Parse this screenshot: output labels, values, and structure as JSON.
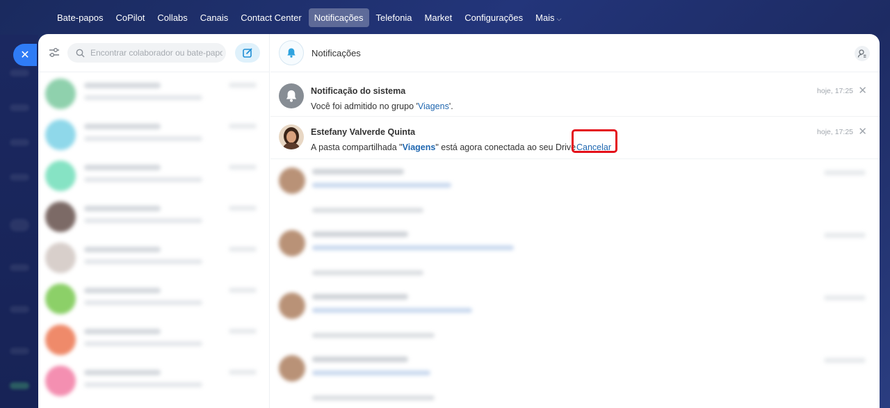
{
  "nav": {
    "items": [
      {
        "label": "Bate-papos",
        "active": false
      },
      {
        "label": "CoPilot",
        "active": false
      },
      {
        "label": "Collabs",
        "active": false
      },
      {
        "label": "Canais",
        "active": false
      },
      {
        "label": "Contact Center",
        "active": false
      },
      {
        "label": "Notificações",
        "active": true
      },
      {
        "label": "Telefonia",
        "active": false
      },
      {
        "label": "Market",
        "active": false
      },
      {
        "label": "Configurações",
        "active": false
      }
    ],
    "more_label": "Mais"
  },
  "chatlist": {
    "search_placeholder": "Encontrar colaborador ou bate-papo",
    "avatar_colors": [
      "#8fd1ad",
      "#8fd8ea",
      "#86e3c4",
      "#7c6a66",
      "#d8cfcb",
      "#8cd068",
      "#ef8a6a",
      "#f48fb1"
    ]
  },
  "notifications": {
    "title": "Notificações",
    "items": [
      {
        "sender": "Notificação do sistema",
        "text_before": "Você foi admitido no grupo '",
        "link": "Viagens",
        "text_after": "'.",
        "time": "hoje, 17:25",
        "icon": "bell-icon"
      },
      {
        "sender": "Estefany Valverde Quinta",
        "text_before": "A pasta compartilhada \"",
        "link": "Viagens",
        "text_after": "\" está agora conectada ao seu Drive",
        "action": "Cancelar",
        "time": "hoje, 17:25"
      }
    ]
  },
  "colors": {
    "accent": "#2f7cf6",
    "link": "#2067b0",
    "highlight": "#e4101a"
  }
}
